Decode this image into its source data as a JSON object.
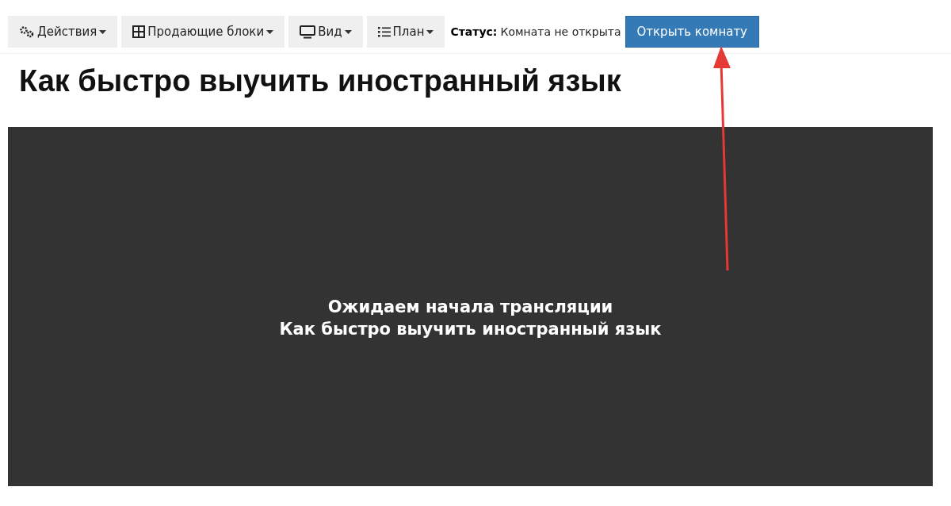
{
  "toolbar": {
    "menus": [
      {
        "label": "Действия",
        "kind": "gears"
      },
      {
        "label": "Продающие блоки",
        "kind": "grid"
      },
      {
        "label": "Вид",
        "kind": "monitor"
      },
      {
        "label": "План",
        "kind": "list"
      }
    ],
    "status": {
      "label": "Статус:",
      "value": "Комната не открыта"
    },
    "open_button": "Открыть комнату"
  },
  "title": "Как быстро выучить иностранный язык",
  "player": {
    "lines": [
      "Ожидаем начала трансляции",
      "Как быстро выучить иностранный язык"
    ]
  }
}
